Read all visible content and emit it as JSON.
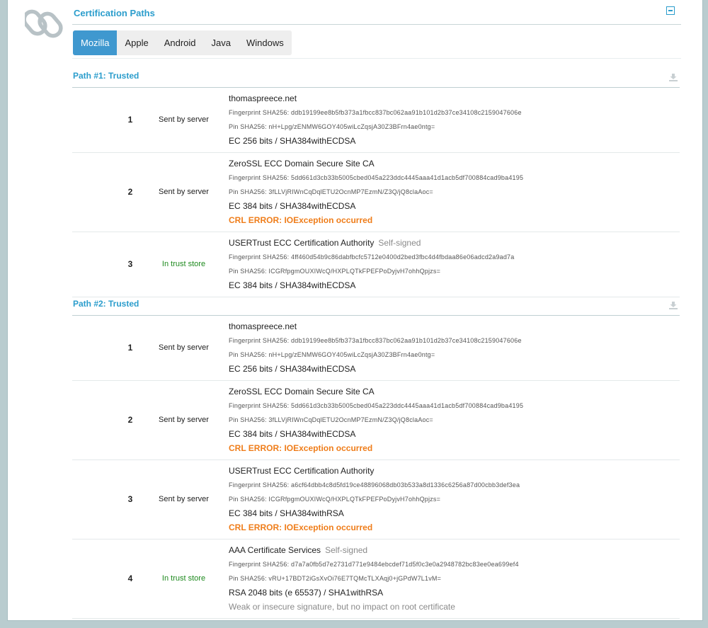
{
  "section": {
    "title": "Certification Paths"
  },
  "tabs": [
    "Mozilla",
    "Apple",
    "Android",
    "Java",
    "Windows"
  ],
  "active_tab": 0,
  "colors": {
    "accent": "#2b9dcc",
    "tab_active": "#3f98cf",
    "error": "#ef7d1a",
    "trust": "#1e8a1e"
  },
  "paths": [
    {
      "title": "Path #1: Trusted",
      "certs": [
        {
          "num": "1",
          "source": "Sent by server",
          "name": "thomaspreece.net",
          "self_signed": "",
          "fingerprint": "Fingerprint SHA256: ddb19199ee8b5fb373a1fbcc837bc062aa91b101d2b37ce34108c2159047606e",
          "pin": "Pin SHA256: nH+Lpg/zENMW6GOY405wiLcZqsjA30Z3BFrn4ae0ntg=",
          "key": "EC 256 bits / SHA384withECDSA",
          "error": "",
          "note": ""
        },
        {
          "num": "2",
          "source": "Sent by server",
          "name": "ZeroSSL ECC Domain Secure Site CA",
          "self_signed": "",
          "fingerprint": "Fingerprint SHA256: 5dd661d3cb33b5005cbed045a223ddc4445aaa41d1acb5df700884cad9ba4195",
          "pin": "Pin SHA256: 3fLLVjRIWnCqDqlETU2OcnMP7EzmN/Z3Q/jQ8claAoc=",
          "key": "EC 384 bits / SHA384withECDSA",
          "error": "CRL ERROR: IOException occurred",
          "note": ""
        },
        {
          "num": "3",
          "source": "In trust store",
          "name": "USERTrust ECC Certification Authority",
          "self_signed": "Self-signed",
          "fingerprint": "Fingerprint SHA256: 4ff460d54b9c86dabfbcfc5712e0400d2bed3fbc4d4fbdaa86e06adcd2a9ad7a",
          "pin": "Pin SHA256: ICGRfpgmOUXIWcQ/HXPLQTkFPEFPoDyjvH7ohhQpjzs=",
          "key": "EC 384 bits / SHA384withECDSA",
          "error": "",
          "note": ""
        }
      ]
    },
    {
      "title": "Path #2: Trusted",
      "certs": [
        {
          "num": "1",
          "source": "Sent by server",
          "name": "thomaspreece.net",
          "self_signed": "",
          "fingerprint": "Fingerprint SHA256: ddb19199ee8b5fb373a1fbcc837bc062aa91b101d2b37ce34108c2159047606e",
          "pin": "Pin SHA256: nH+Lpg/zENMW6GOY405wiLcZqsjA30Z3BFrn4ae0ntg=",
          "key": "EC 256 bits / SHA384withECDSA",
          "error": "",
          "note": ""
        },
        {
          "num": "2",
          "source": "Sent by server",
          "name": "ZeroSSL ECC Domain Secure Site CA",
          "self_signed": "",
          "fingerprint": "Fingerprint SHA256: 5dd661d3cb33b5005cbed045a223ddc4445aaa41d1acb5df700884cad9ba4195",
          "pin": "Pin SHA256: 3fLLVjRIWnCqDqlETU2OcnMP7EzmN/Z3Q/jQ8claAoc=",
          "key": "EC 384 bits / SHA384withECDSA",
          "error": "CRL ERROR: IOException occurred",
          "note": ""
        },
        {
          "num": "3",
          "source": "Sent by server",
          "name": "USERTrust ECC Certification Authority",
          "self_signed": "",
          "fingerprint": "Fingerprint SHA256: a6cf64dbb4c8d5fd19ce48896068db03b533a8d1336c6256a87d00cbb3def3ea",
          "pin": "Pin SHA256: ICGRfpgmOUXIWcQ/HXPLQTkFPEFPoDyjvH7ohhQpjzs=",
          "key": "EC 384 bits / SHA384withRSA",
          "error": "CRL ERROR: IOException occurred",
          "note": ""
        },
        {
          "num": "4",
          "source": "In trust store",
          "name": "AAA Certificate Services",
          "self_signed": "Self-signed",
          "fingerprint": "Fingerprint SHA256: d7a7a0fb5d7e2731d771e9484ebcdef71d5f0c3e0a2948782bc83ee0ea699ef4",
          "pin": "Pin SHA256: vRU+17BDT2iGsXvOi76E7TQMcTLXAqj0+jGPdW7L1vM=",
          "key": "RSA 2048 bits (e 65537) / SHA1withRSA",
          "error": "",
          "note": "Weak or insecure signature, but no impact on root certificate"
        }
      ]
    }
  ]
}
